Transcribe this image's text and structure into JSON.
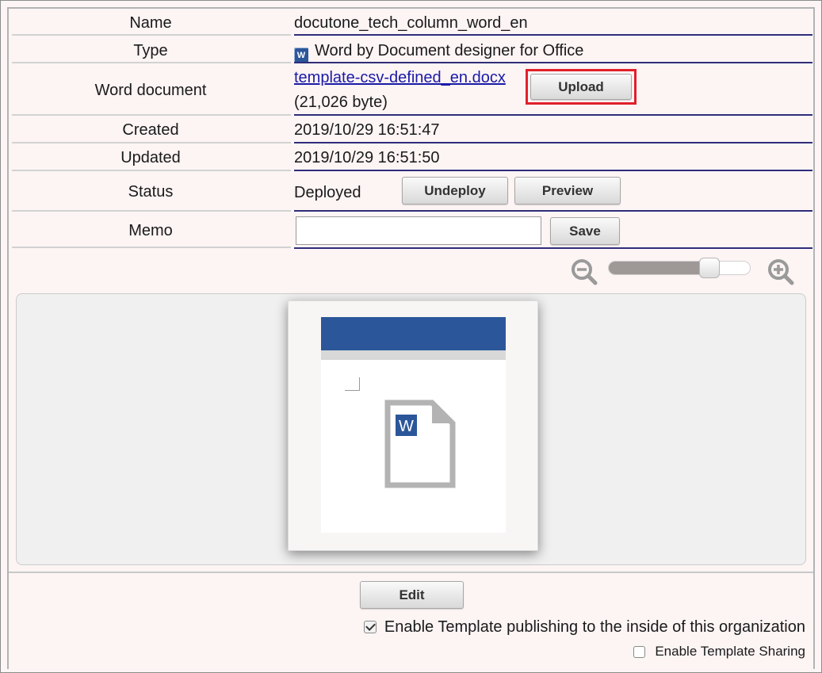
{
  "fields": {
    "name": {
      "label": "Name",
      "value": "docutone_tech_column_word_en"
    },
    "type": {
      "label": "Type",
      "icon": "word-file-icon",
      "icon_letter": "W",
      "value": "Word by Document designer for Office"
    },
    "word_document": {
      "label": "Word document",
      "file_link": "template-csv-defined_en.docx",
      "size": "(21,026 byte)",
      "upload_label": "Upload"
    },
    "created": {
      "label": "Created",
      "value": "2019/10/29 16:51:47"
    },
    "updated": {
      "label": "Updated",
      "value": "2019/10/29 16:51:50"
    },
    "status": {
      "label": "Status",
      "value": "Deployed",
      "undeploy_label": "Undeploy",
      "preview_label": "Preview"
    },
    "memo": {
      "label": "Memo",
      "value": "",
      "placeholder": "",
      "save_label": "Save"
    }
  },
  "zoom": {
    "level": 0.71,
    "zoom_out_icon": "zoom-out-icon",
    "zoom_in_icon": "zoom-in-icon"
  },
  "preview": {
    "icon": "word-document-icon",
    "icon_letter": "W"
  },
  "actions": {
    "edit_label": "Edit"
  },
  "options": {
    "publishing": {
      "label": "Enable Template publishing to the inside of this organization",
      "checked": true
    },
    "sharing": {
      "label": "Enable Template Sharing",
      "checked": false
    }
  },
  "colors": {
    "highlight": "#e0202a",
    "link": "#1a1aa6",
    "word_blue": "#2b579a",
    "row_line": "#2e2e7a",
    "background": "#fdf4f4"
  }
}
